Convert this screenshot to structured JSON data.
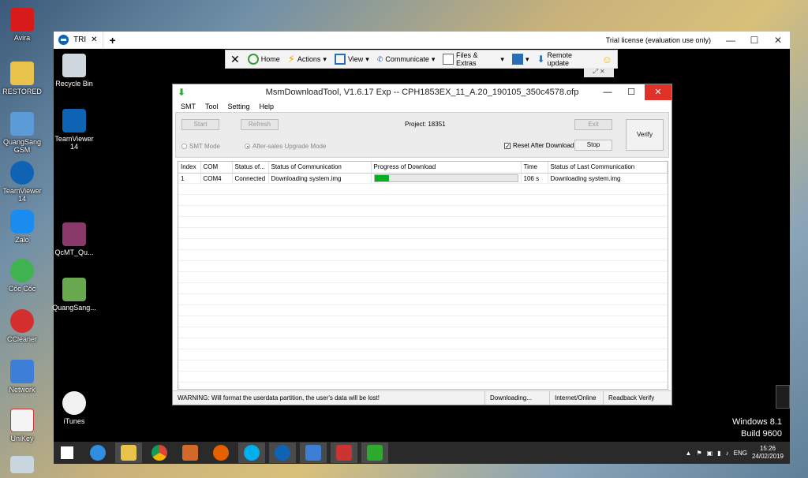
{
  "outer_desktop": {
    "icons": [
      "Avira",
      "RESTORED",
      "QuangSang GSM",
      "TeamViewer 14",
      "Zalo",
      "Cốc Cốc",
      "CCleaner",
      "Network",
      "UniKey",
      ""
    ]
  },
  "teamviewer": {
    "tab_label": "TRI",
    "license_text": "Trial license (evaluation use only)",
    "toolbar": {
      "home": "Home",
      "actions": "Actions",
      "view": "View",
      "communicate": "Communicate",
      "files": "Files & Extras",
      "remote_update": "Remote update"
    }
  },
  "inner_desktop": {
    "icons": [
      "Recycle Bin",
      "TeamViewer 14",
      "QcMT_Qu...",
      "QuangSang...",
      "iTunes"
    ],
    "watermark_line1": "Windows 8.1",
    "watermark_line2": "Build 9600"
  },
  "msm": {
    "title": "MsmDownloadTool, V1.6.17 Exp -- CPH1853EX_11_A.20_190105_350c4578.ofp",
    "menu": [
      "SMT",
      "Tool",
      "Setting",
      "Help"
    ],
    "buttons": {
      "start": "Start",
      "refresh": "Refresh",
      "exit": "Exit",
      "stop": "Stop",
      "verify": "Verify"
    },
    "project_label": "Project: 18351",
    "radio_smt": "SMT Mode",
    "radio_aftersales": "After-sales Upgrade Mode",
    "checkbox_reset": "Reset After Download",
    "table": {
      "headers": [
        "Index",
        "COM",
        "Status of...",
        "Status of Communication",
        "Progress of Download",
        "Time",
        "Status of Last Communication"
      ],
      "rows": [
        {
          "index": "1",
          "com": "COM4",
          "status": "Connected",
          "comm": "Downloading system.img",
          "progress": 0.1,
          "time": "106 s",
          "last": "Downloading system.img"
        }
      ]
    },
    "status_bar": {
      "warning": "WARNING: Will format the userdata partition, the user's data will be lost!",
      "state": "Downloading...",
      "network": "Internet/Online",
      "readback": "Readback Verify"
    }
  },
  "tray": {
    "lang": "ENG",
    "time": "15:26",
    "date": "24/02/2019"
  },
  "colors": {
    "progress_fill": "#06b025",
    "msm_close": "#e0302a",
    "teamviewer_blue": "#0e63b5"
  }
}
